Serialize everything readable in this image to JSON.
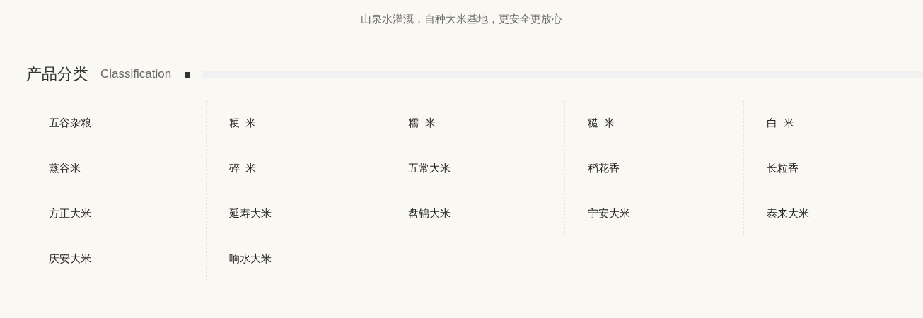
{
  "tagline": "山泉水灌溉，自种大米基地，更安全更放心",
  "section": {
    "title": "产品分类",
    "subtitle": "Classification"
  },
  "categories": [
    "五谷杂粮",
    "粳  米",
    "糯  米",
    "糙  米",
    "白  米",
    "蒸谷米",
    "碎  米",
    "五常大米",
    "稻花香",
    "长粒香",
    "方正大米",
    "延寿大米",
    "盘锦大米",
    "宁安大米",
    "泰来大米",
    "庆安大米",
    "响水大米"
  ]
}
